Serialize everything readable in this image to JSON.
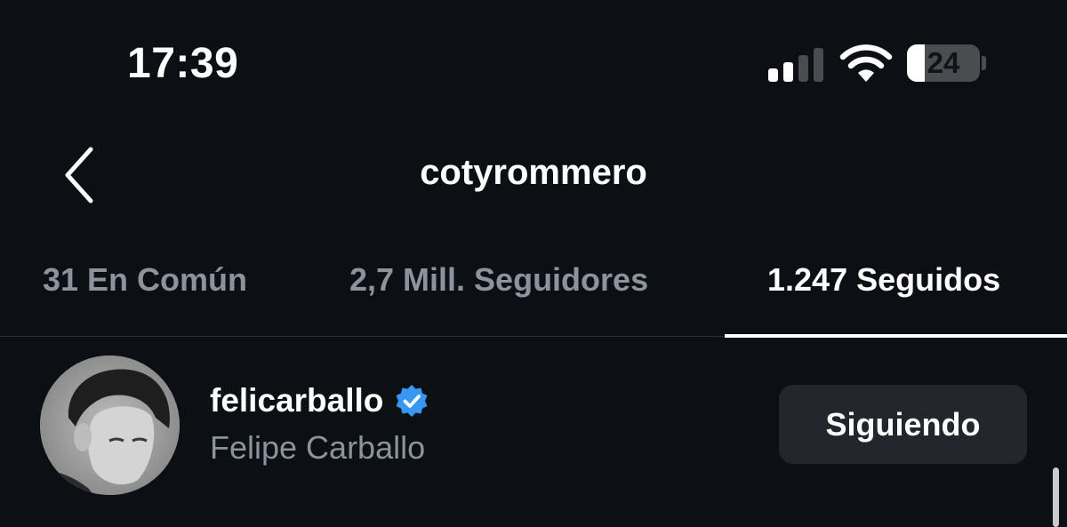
{
  "status_bar": {
    "time": "17:39",
    "battery_level": "24",
    "battery_fraction": 0.24,
    "signal_bars_active": 2,
    "signal_bars_total": 4
  },
  "header": {
    "title": "cotyrommero",
    "back_icon": "chevron-left-icon"
  },
  "tabs": [
    {
      "label": "31 En Común",
      "active": false
    },
    {
      "label": "2,7 Mill. Seguidores",
      "active": false
    },
    {
      "label": "1.247 Seguidos",
      "active": true
    }
  ],
  "list": {
    "items": [
      {
        "username": "felicarballo",
        "full_name": "Felipe Carballo",
        "verified": true,
        "button_label": "Siguiendo"
      }
    ]
  },
  "colors": {
    "background": "#0c0f14",
    "verified_badge": "#3897f0",
    "secondary_text": "#8d939d",
    "button_bg": "#23262c"
  }
}
